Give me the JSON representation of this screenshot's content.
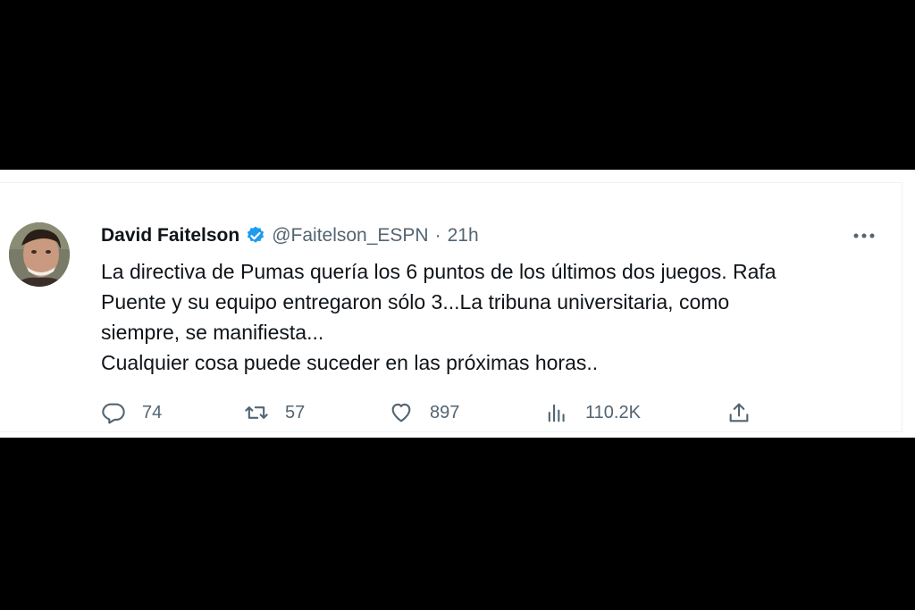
{
  "tweet": {
    "author_name": "David Faitelson",
    "handle": "@Faitelson_ESPN",
    "separator": "·",
    "time": "21h",
    "more_icon": "more-horizontal-icon",
    "text_lines": [
      "La directiva de Pumas quería los 6 puntos de los últimos dos juegos. Rafa",
      "Puente y su equipo entregaron sólo 3...La tribuna universitaria, como",
      "siempre, se manifiesta...",
      "Cualquier cosa puede suceder en las próximas horas.."
    ],
    "actions": {
      "replies": "74",
      "retweets": "57",
      "likes": "897",
      "views": "110.2K"
    }
  },
  "colors": {
    "background": "#000000",
    "card": "#ffffff",
    "text": "#0f1419",
    "secondary": "#536471",
    "verified": "#1d9bf0"
  }
}
